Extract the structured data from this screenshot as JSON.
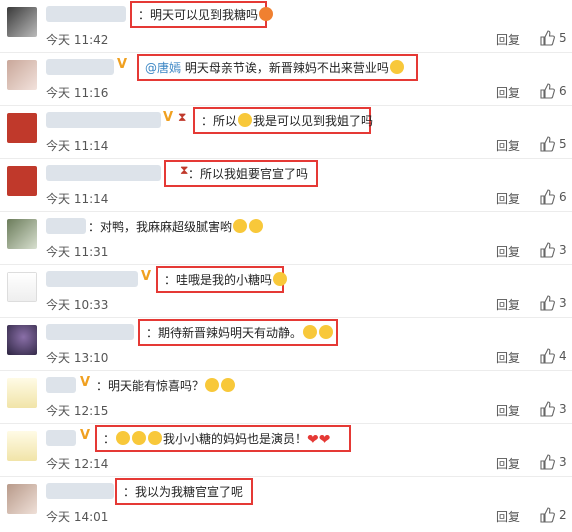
{
  "colors": {
    "highlight_border": "#e53935",
    "mention": "#3b86c4",
    "vip_badge": "#f0a020",
    "heart": "#e53935"
  },
  "actions": {
    "reply_label": "回复"
  },
  "comments": [
    {
      "text": "：明天可以见到我糖吗",
      "time": "今天 11:42",
      "likes": "5"
    },
    {
      "mention": "@唐嫣",
      "text": " 明天母亲节诶，新晋辣妈不出来营业吗",
      "time": "今天 11:16",
      "likes": "6"
    },
    {
      "text": "：所以",
      "text2": "我是可以见到我姐了吗",
      "time": "今天 11:14",
      "likes": "5"
    },
    {
      "text": "：所以我姐要官宣了吗",
      "time": "今天 11:14",
      "likes": "6"
    },
    {
      "text": "：对鸭，我麻麻超级腻害哟",
      "time": "今天 11:31",
      "likes": "3"
    },
    {
      "text": "：哇哦是我的小糖吗",
      "time": "今天 10:33",
      "likes": "3"
    },
    {
      "text": "：期待新晋辣妈明天有动静。",
      "time": "今天 13:10",
      "likes": "4"
    },
    {
      "text": "：明天能有惊喜吗？",
      "time": "今天 12:15",
      "likes": "3"
    },
    {
      "text": "：",
      "text2": "我小小糖的妈妈也是演员！",
      "time": "今天 12:14",
      "likes": "3"
    },
    {
      "text": "：我以为我糖官宣了呢",
      "time": "今天 14:01",
      "likes": "2"
    }
  ]
}
